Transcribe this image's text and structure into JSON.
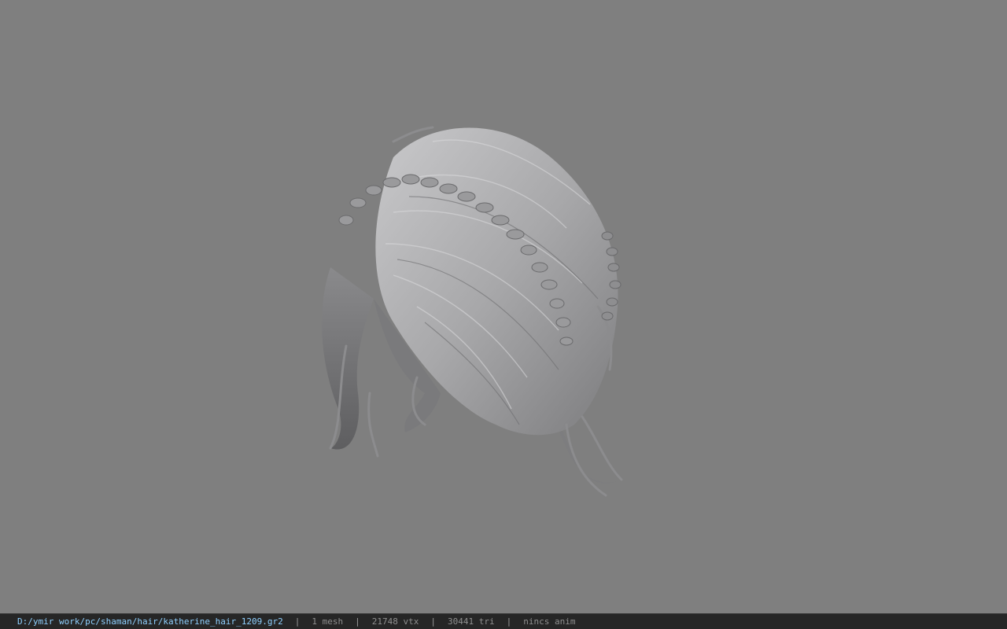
{
  "viewport": {
    "background_color": "#7f7f7f",
    "model_icon": "hair-mesh-3d-render"
  },
  "status_bar": {
    "file_path": "D:/ymir work/pc/shaman/hair/katherine_hair_1209.gr2",
    "separator": "|",
    "mesh_count": "1 mesh",
    "vertex_count": "21748 vtx",
    "triangle_count": "30441 tri",
    "animation": "nincs anim"
  }
}
